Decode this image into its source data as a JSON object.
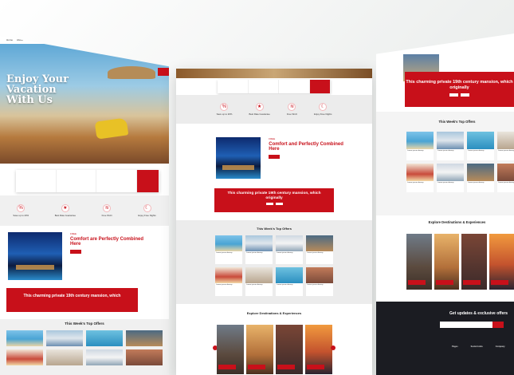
{
  "hero": {
    "title_line1": "Enjoy Your",
    "title_line2": "Vacation",
    "title_line3": "With Us"
  },
  "featured": {
    "tag": "FREE",
    "heading": "Comfort and Perfectly Combined Here",
    "heading_left": "Comfort are Perfectly Combined Here"
  },
  "features": [
    {
      "label": "Save up to 20%",
      "icon": "percent-icon"
    },
    {
      "label": "Best Rate Guarantee",
      "icon": "badge-icon"
    },
    {
      "label": "Free Wi-Fi",
      "icon": "wifi-icon"
    },
    {
      "label": "Enjoy Free Nights",
      "icon": "moon-icon"
    }
  ],
  "banner": {
    "text_line1": "This charming private 19th century mansion, which",
    "text_line2": "originally"
  },
  "offers": {
    "title": "This Week's Top Offers",
    "items": [
      "Lorem ipsum dummy",
      "Lorem ipsum dummy",
      "Lorem ipsum dummy",
      "Lorem ipsum dummy",
      "Lorem ipsum dummy",
      "Lorem ipsum dummy",
      "Lorem ipsum dummy",
      "Lorem ipsum dummy"
    ]
  },
  "destinations": {
    "title": "Explore Destinations & Experiences"
  },
  "newsletter": {
    "title": "Get updates & exclusive offers",
    "columns": [
      "Pages",
      "Social Links",
      "Company"
    ]
  },
  "colors": {
    "accent": "#c8101a",
    "dark": "#1b1c22"
  }
}
